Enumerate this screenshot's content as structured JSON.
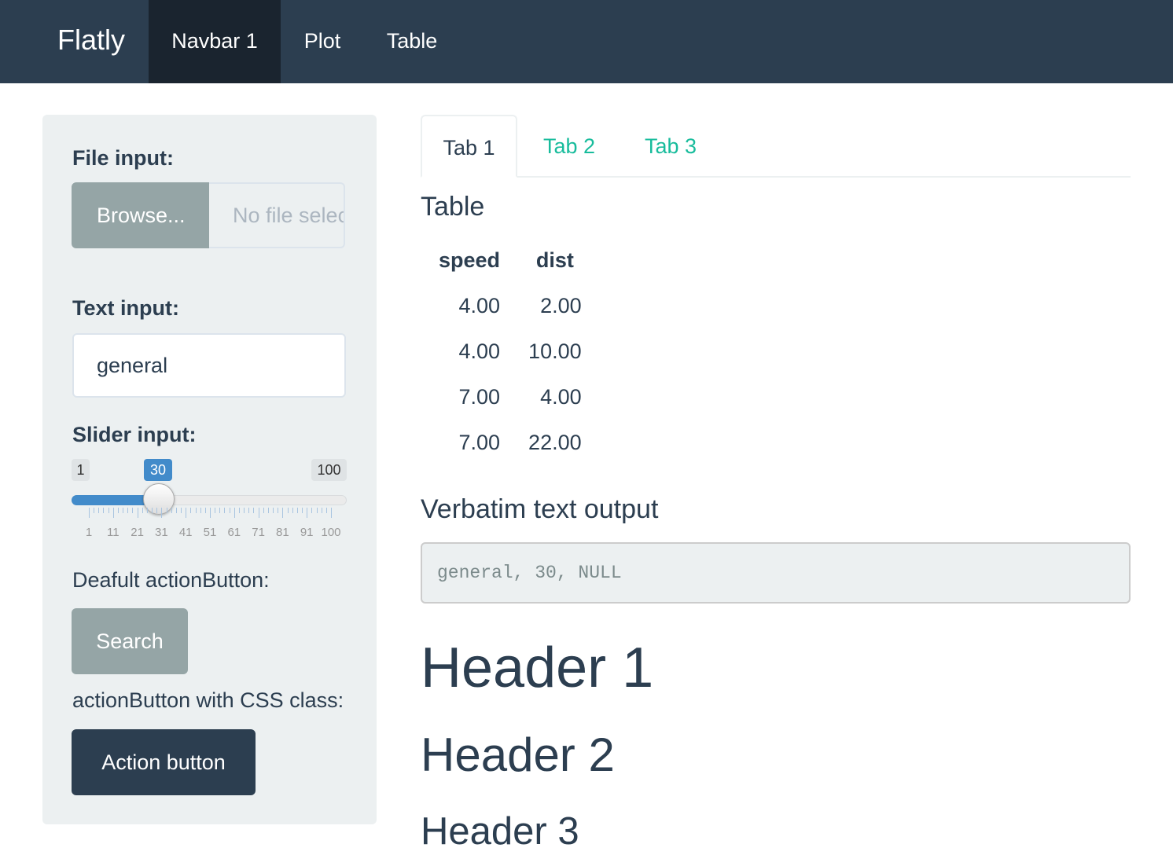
{
  "navbar": {
    "brand": "Flatly",
    "items": [
      {
        "label": "Navbar 1",
        "active": true
      },
      {
        "label": "Plot",
        "active": false
      },
      {
        "label": "Table",
        "active": false
      }
    ]
  },
  "sidebar": {
    "file_input": {
      "label": "File input:",
      "button_label": "Browse...",
      "placeholder": "No file selected"
    },
    "text_input": {
      "label": "Text input:",
      "value": "general"
    },
    "slider": {
      "label": "Slider input:",
      "min": "1",
      "max": "100",
      "value": "30",
      "fraction": 0.293,
      "ticks": [
        "1",
        "11",
        "21",
        "31",
        "41",
        "51",
        "61",
        "71",
        "81",
        "91",
        "100"
      ]
    },
    "default_button": {
      "label": "Deafult actionButton:",
      "button_label": "Search"
    },
    "css_button": {
      "label": "actionButton with CSS class:",
      "button_label": "Action button"
    }
  },
  "colors": {
    "navbar": "#2c3e50",
    "nav_active": "#1a242f",
    "accent": "#18bc9c",
    "slider": "#428bca",
    "well": "#ecf0f1",
    "default_btn": "#95a5a6"
  },
  "main": {
    "tabs": [
      {
        "label": "Tab 1",
        "active": true
      },
      {
        "label": "Tab 2",
        "active": false
      },
      {
        "label": "Tab 3",
        "active": false
      }
    ],
    "table_title": "Table",
    "table": {
      "columns": [
        "speed",
        "dist"
      ],
      "rows": [
        [
          "4.00",
          "2.00"
        ],
        [
          "4.00",
          "10.00"
        ],
        [
          "7.00",
          "4.00"
        ],
        [
          "7.00",
          "22.00"
        ]
      ]
    },
    "verbatim_title": "Verbatim text output",
    "verbatim_text": "general, 30, NULL",
    "header1": "Header 1",
    "header2": "Header 2",
    "header3": "Header 3"
  }
}
